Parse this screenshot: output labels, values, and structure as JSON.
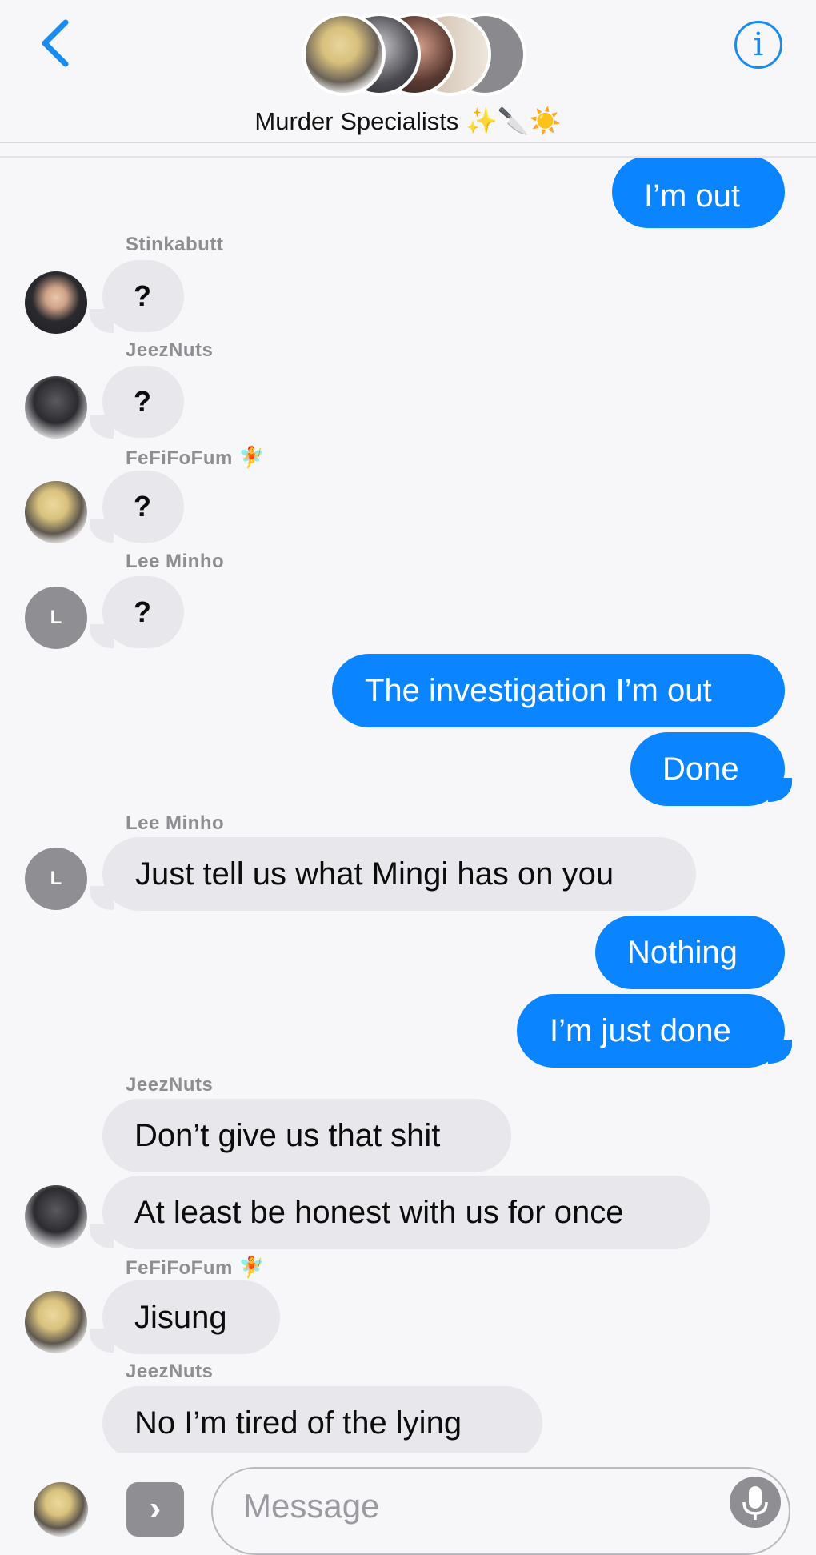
{
  "header": {
    "title": "Murder Specialists",
    "title_emoji": "✨🔪☀️",
    "back_icon": "chevron-left-icon",
    "info_icon": "info-icon",
    "info_glyph": "i"
  },
  "messages": [
    {
      "text": "I’m out"
    },
    {
      "sender": "Stinkabutt",
      "text": "?"
    },
    {
      "sender": "JeezNuts",
      "text": "?"
    },
    {
      "sender": "FeFiFoFum",
      "sender_emoji": "🧚",
      "text": "?"
    },
    {
      "sender": "Lee Minho",
      "avatar_letter": "L",
      "text": "?"
    },
    {
      "text": "The investigation I’m out"
    },
    {
      "text": "Done"
    },
    {
      "sender": "Lee Minho",
      "avatar_letter": "L",
      "text": "Just tell us what Mingi has on you"
    },
    {
      "text": "Nothing"
    },
    {
      "text": "I’m just done"
    },
    {
      "sender": "JeezNuts",
      "text": "Don’t give us that shit"
    },
    {
      "text": "At least be honest with us for once"
    },
    {
      "sender": "FeFiFoFum",
      "sender_emoji": "🧚",
      "text": "Jisung"
    },
    {
      "sender": "JeezNuts",
      "text": "No I’m tired of the lying"
    }
  ],
  "composer": {
    "placeholder": "Message",
    "apps_icon": "chevron-right-icon",
    "mic_icon": "microphone-icon"
  },
  "colors": {
    "outgoing": "#0b84ff",
    "incoming": "#e8e7ec",
    "accent": "#1a8cf0"
  }
}
